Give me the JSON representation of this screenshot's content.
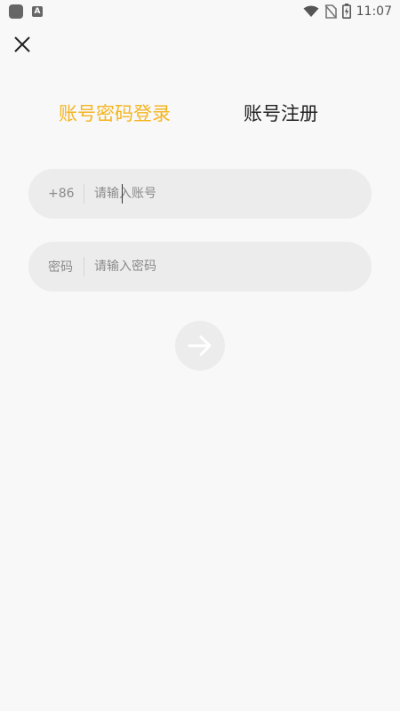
{
  "status_bar": {
    "time": "11:07",
    "left_icons": [
      "app-icon",
      "a-badge-icon"
    ],
    "a_badge": "A",
    "right_icons": [
      "wifi-icon",
      "no-sim-icon",
      "battery-charging-icon"
    ]
  },
  "close": {
    "icon": "close-icon"
  },
  "tabs": [
    {
      "label": "账号密码登录",
      "active": true
    },
    {
      "label": "账号注册",
      "active": false
    }
  ],
  "form": {
    "phone": {
      "prefix": "+86",
      "placeholder": "请输入账号",
      "value": ""
    },
    "password": {
      "prefix": "密码",
      "placeholder": "请输入密码",
      "value": ""
    },
    "submit_icon": "arrow-right-icon"
  },
  "colors": {
    "accent": "#f4b51f",
    "background": "#f8f8f8",
    "field_bg": "#ececec",
    "inactive_tab": "#222222",
    "placeholder": "#8a8a8a"
  }
}
